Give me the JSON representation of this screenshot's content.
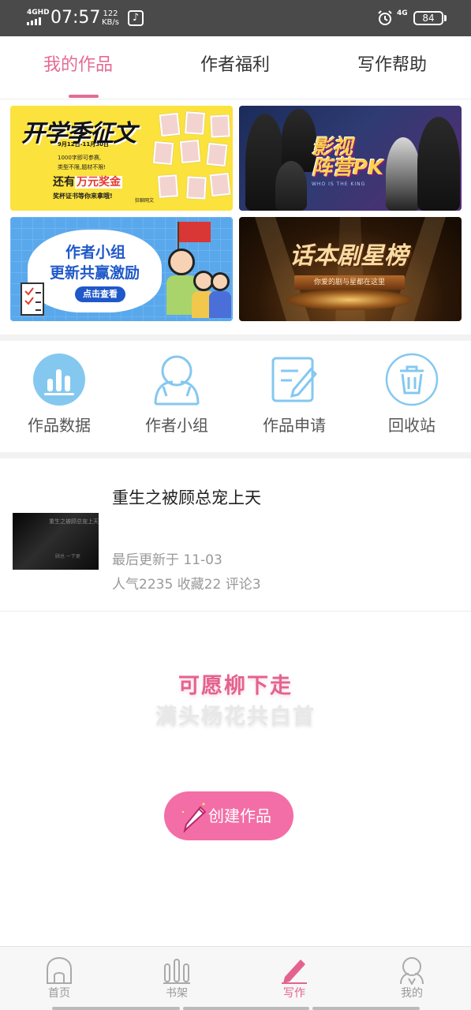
{
  "status_bar": {
    "network_left": "4GHD",
    "time": "07:57",
    "speed_value": "122",
    "speed_unit": "KB/s",
    "network_right": "4G",
    "battery": "84"
  },
  "tabs": [
    {
      "label": "我的作品",
      "active": true
    },
    {
      "label": "作者福利",
      "active": false
    },
    {
      "label": "写作帮助",
      "active": false
    }
  ],
  "banners": {
    "b1": {
      "title": "开学季征文",
      "date": "9月12日-11月30日",
      "line1": "1000字即可参赛,",
      "line2": "类型不限,题材不限!",
      "prize_prefix": "还有",
      "prize_highlight": "万元奖金",
      "line3": "奖杯证书等你来拿哦!",
      "brand": "狂聊网文"
    },
    "b2": {
      "title_line1": "影视",
      "title_line2": "阵营PK",
      "sub": "WHO IS THE KING"
    },
    "b3": {
      "line1": "作者小组",
      "line2": "更新共赢激励",
      "button": "点击查看"
    },
    "b4": {
      "title": "话本剧星榜",
      "sub": "你爱的剧与星都在这里"
    }
  },
  "quick_actions": [
    {
      "label": "作品数据",
      "icon": "bar-chart-icon"
    },
    {
      "label": "作者小组",
      "icon": "group-icon"
    },
    {
      "label": "作品申请",
      "icon": "edit-document-icon"
    },
    {
      "label": "回收站",
      "icon": "trash-icon"
    }
  ],
  "work": {
    "title": "重生之被顾总宠上天",
    "cover_text": "重生之被顾总宠上天",
    "cover_text2": "顾总 一下更",
    "update": "最后更新于 11-03",
    "stats": "人气2235 收藏22 评论3"
  },
  "quote": {
    "line1": "可愿柳下走",
    "line2": "满头杨花共白首"
  },
  "create_button": "创建作品",
  "bottom_nav": [
    {
      "label": "首页",
      "icon": "home-icon",
      "active": false
    },
    {
      "label": "书架",
      "icon": "bookshelf-icon",
      "active": false
    },
    {
      "label": "写作",
      "icon": "pen-icon",
      "active": true
    },
    {
      "label": "我的",
      "icon": "profile-icon",
      "active": false
    }
  ],
  "colors": {
    "accent": "#e4628e",
    "button": "#f36ea6",
    "icon_blue": "#5bb3e8"
  }
}
